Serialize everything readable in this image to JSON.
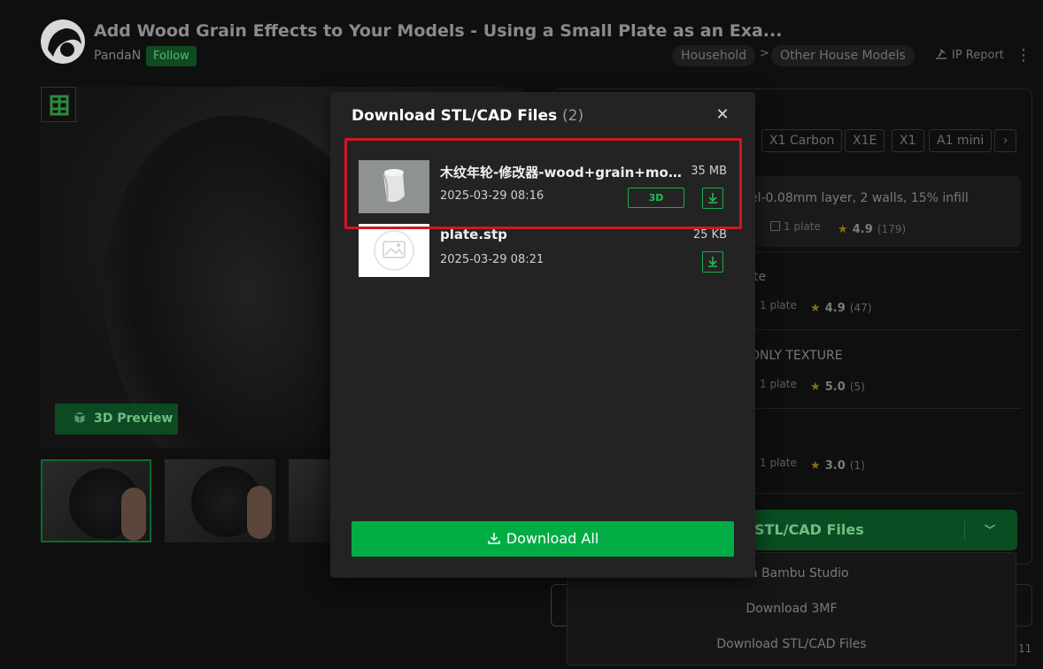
{
  "header": {
    "title": "Add Wood Grain Effects to Your Models - Using a Small Plate as an Exa...",
    "author": "PandaN",
    "follow_label": "Follow",
    "breadcrumbs": [
      "Household",
      "Other House Models"
    ],
    "breadcrumb_separator": ">",
    "ip_report": "IP Report"
  },
  "gallery": {
    "preview_button": "3D Preview"
  },
  "right_panel": {
    "printers": [
      "X1 Carbon",
      "X1E",
      "X1",
      "A1 mini"
    ],
    "profiles": [
      {
        "title": "el-0.08mm layer, 2 walls, 15% infill",
        "plates": "1 plate",
        "rating": "4.9",
        "count": "(179)"
      },
      {
        "title": "te",
        "plates": "1 plate",
        "rating": "4.9",
        "count": "(47)"
      },
      {
        "title": "ONLY TEXTURE",
        "plates": "1 plate",
        "rating": "5.0",
        "count": "(5)"
      },
      {
        "title": "",
        "plates": "1 plate",
        "rating": "3.0",
        "count": "(1)"
      }
    ],
    "stl_button": "STL/CAD Files",
    "dropdown": [
      "n in Bambu Studio",
      "Download 3MF",
      "Download STL/CAD Files"
    ],
    "page_num": "11"
  },
  "modal": {
    "title": "Download STL/CAD Files",
    "count": "(2)",
    "files": [
      {
        "name": "木纹年轮-修改器-wood+grain+modifier.stl",
        "date": "2025-03-29 08:16",
        "size": "35 MB",
        "badge": "3D"
      },
      {
        "name": "plate.stp",
        "date": "2025-03-29 08:21",
        "size": "25 KB",
        "badge": ""
      }
    ],
    "download_all": "Download All"
  },
  "colors": {
    "accent_green": "#00ad45",
    "highlight_red": "#d0181c",
    "modal_bg": "#232323"
  }
}
